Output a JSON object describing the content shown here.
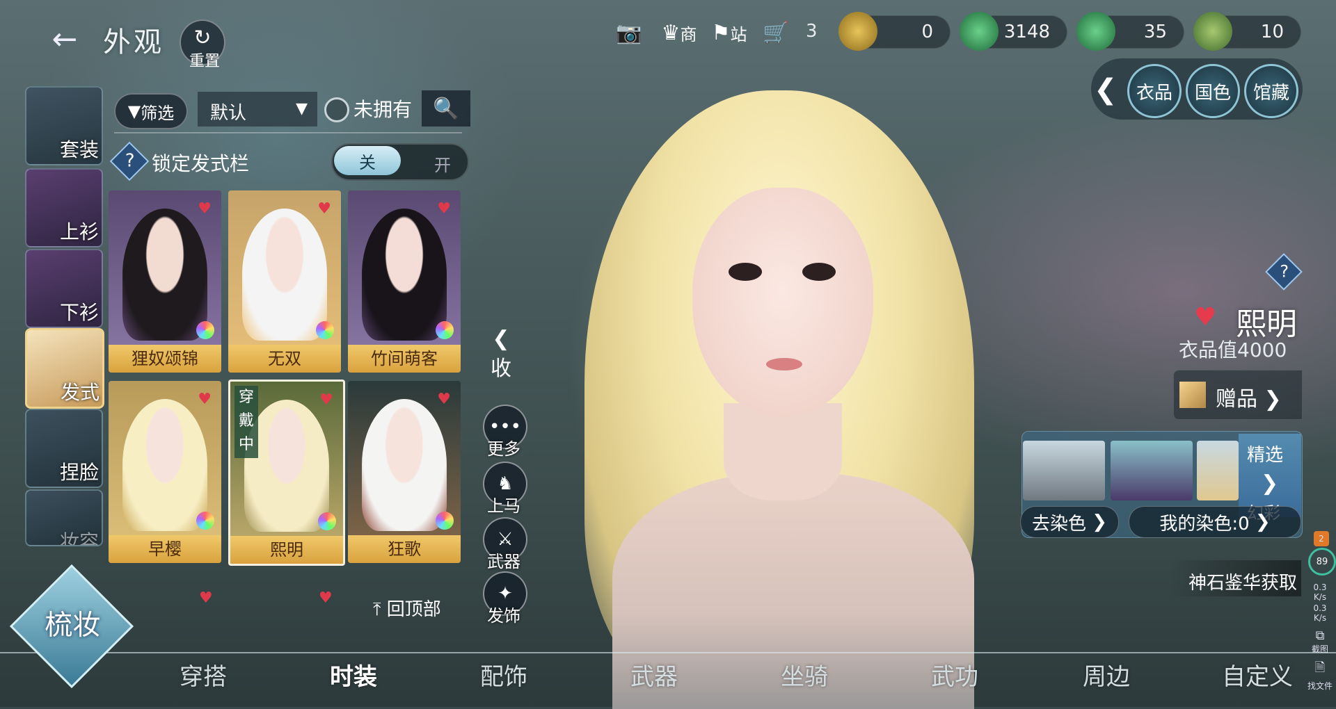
{
  "header": {
    "title": "外观",
    "reset_label": "重置",
    "shop_label": "商",
    "station_label": "站",
    "cart_count": "3",
    "currencies": [
      {
        "name": "gold-coin",
        "value": "0",
        "color": "#c9a22a"
      },
      {
        "name": "jade-coin",
        "value": "3148",
        "color": "#3aa65a"
      },
      {
        "name": "jade-coin-2",
        "value": "35",
        "color": "#3aa65a"
      },
      {
        "name": "jade-coin-3",
        "value": "10",
        "color": "#3aa65a"
      }
    ]
  },
  "right_tabs": [
    "衣品",
    "国色",
    "馆藏"
  ],
  "sidebar": {
    "items": [
      {
        "label": "套装"
      },
      {
        "label": "上衫"
      },
      {
        "label": "下衫"
      },
      {
        "label": "发式"
      },
      {
        "label": "捏脸"
      },
      {
        "label": "妆容"
      }
    ]
  },
  "filter": {
    "filter_label": "筛选",
    "sort_value": "默认",
    "not_owned_label": "未拥有",
    "lock_label": "锁定发式栏",
    "toggle_on": "关",
    "toggle_off": "开"
  },
  "grid": {
    "items": [
      {
        "name": "狸奴颂锦",
        "wearing": false
      },
      {
        "name": "无双",
        "wearing": false
      },
      {
        "name": "竹间萌客",
        "wearing": false
      },
      {
        "name": "早樱",
        "wearing": false
      },
      {
        "name": "熙明",
        "wearing": true
      },
      {
        "name": "狂歌",
        "wearing": false
      }
    ],
    "wearing_label": "穿戴中",
    "back_to_top": "回顶部"
  },
  "actions": {
    "collapse": "收",
    "more": "更多",
    "mount": "上马",
    "weapon": "武器",
    "hair_ornament": "发饰"
  },
  "item_info": {
    "name": "熙明",
    "value": "衣品值4000",
    "gift": "赠品",
    "featured": "精选",
    "illusion": "幻彩",
    "dye_remove": "去染色",
    "my_dye": "我的染色:0",
    "obtain": "神石鉴华获取"
  },
  "status": {
    "badge": "2",
    "battery": "89",
    "up": "0.3",
    "up_unit": "K/s",
    "down": "0.3",
    "down_unit": "K/s",
    "screenshot": "截图",
    "find_file": "找文件"
  },
  "bottom_tabs": [
    "穿搭",
    "时装",
    "配饰",
    "武器",
    "坐骑",
    "武功",
    "周边",
    "自定义"
  ],
  "active_bottom_tab": "时装",
  "corner_badge": "梳妆"
}
